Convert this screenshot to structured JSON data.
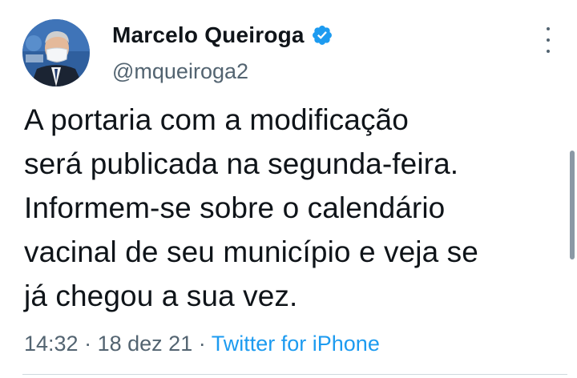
{
  "author": {
    "display_name": "Marcelo Queiroga",
    "handle": "@mqueiroga2",
    "verified": true,
    "avatar_icon": "profile-photo"
  },
  "tweet": {
    "text_lines": [
      "A portaria com a modificação",
      "será publicada na segunda-feira.",
      "Informem-se sobre o calendário",
      "vacinal de seu município e veja se",
      "já chegou a sua vez."
    ],
    "time": "14:32",
    "separator_1": "·",
    "date": "18 dez 21",
    "separator_2": "·",
    "source": "Twitter for iPhone"
  },
  "icons": {
    "verified_badge": "verified-badge-icon",
    "more": "more-options-icon"
  },
  "colors": {
    "text": "#0f1419",
    "secondary": "#536471",
    "link": "#1d9bf0",
    "verified": "#1d9bf0"
  }
}
